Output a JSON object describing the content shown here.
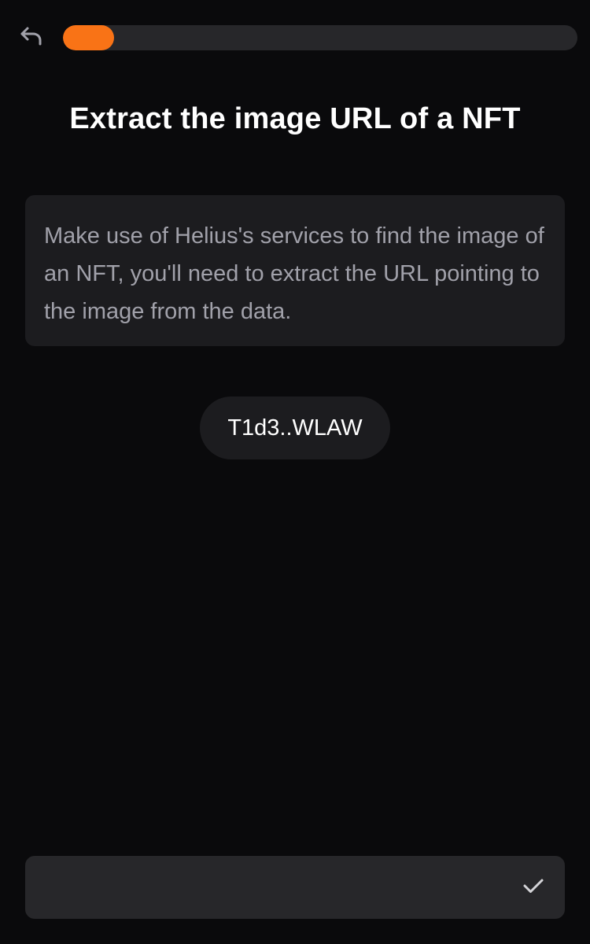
{
  "header": {
    "back_icon": "undo-arrow-icon",
    "progress_percent": 10,
    "progress_color": "#f97316"
  },
  "challenge": {
    "title": "Extract the image URL of a NFT",
    "description": "Make use of Helius's services to find the image of an NFT, you'll need to extract the URL pointing to the image from the data.",
    "address_label": "T1d3..WLAW"
  },
  "answer": {
    "value": "",
    "placeholder": "",
    "submit_icon": "checkmark-icon"
  }
}
